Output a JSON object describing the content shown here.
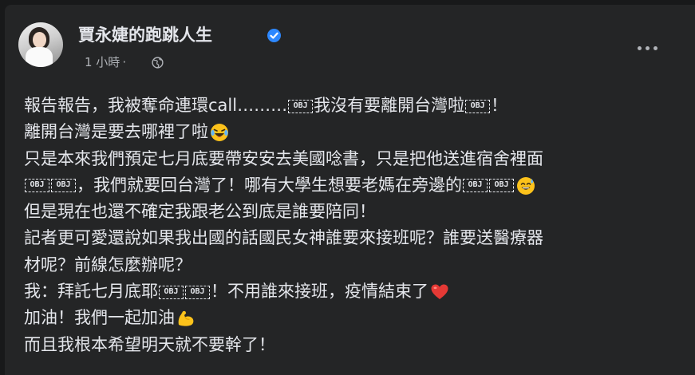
{
  "post": {
    "page_name": "賈永婕的跑跳人生",
    "timestamp": "1 小時",
    "separator": "·",
    "privacy_icon": "globe-icon",
    "verified_icon": "verified-badge-icon",
    "more_icon": "more-options-icon"
  },
  "body": {
    "obj": "OBJ",
    "l1a": "報告報告，我被奪命連環call………",
    "l1b": "我沒有要離開台灣啦",
    "l1c": "！",
    "l2": "離開台灣是要去哪裡了啦",
    "l3": "只是本來我們預定七月底要帶安安去美國唸書，只是把他送進宿舍裡面",
    "l4a": "，我們就要回台灣了！哪有大學生想要老媽在旁邊的",
    "l5": "但是現在也還不確定我跟老公到底是誰要陪同！",
    "l6": "記者更可愛還說如果我出國的話國民女神誰要來接班呢？誰要送醫療器",
    "l7": "材呢？前線怎麼辦呢？",
    "l8a": "我：拜託七月底耶",
    "l8b": "！不用誰來接班，疫情結束了",
    "l9": "加油！我們一起加油",
    "l10": "而且我根本希望明天就不要幹了！"
  },
  "emojis": [
    "laughing-tears-emoji",
    "sweat-smile-emoji",
    "red-heart-emoji",
    "flexed-biceps-emoji"
  ],
  "colors": {
    "background": "#18191a",
    "card": "#242526",
    "primary_text": "#e4e6eb",
    "secondary_text": "#b0b3b8",
    "verified_blue": "#2d88ff"
  }
}
